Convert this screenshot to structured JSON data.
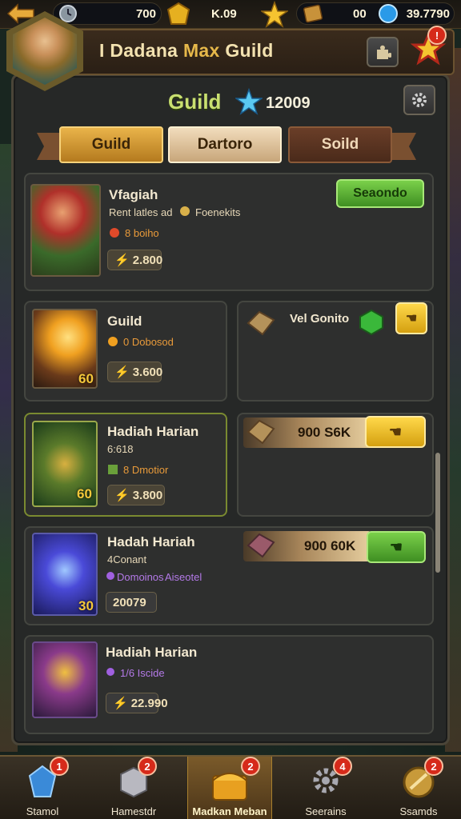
{
  "topbar": {
    "resources": [
      {
        "icon": "clock-coin-icon",
        "value": "700"
      },
      {
        "icon": "gold-coin-icon",
        "value": "K.09"
      },
      {
        "icon": "star-icon",
        "value": ""
      },
      {
        "icon": "scroll-icon",
        "value": "00"
      },
      {
        "icon": "blue-gem-icon",
        "value": "39.7790"
      }
    ]
  },
  "header": {
    "title_prefix": "I Dadana ",
    "title_highlight": "Max",
    "title_suffix": " Guild",
    "notification_count": "!"
  },
  "guild": {
    "name": "Guild",
    "score": "12009"
  },
  "tabs": [
    {
      "label": "Guild",
      "state": "selected-gold"
    },
    {
      "label": "Dartoro",
      "state": "active"
    },
    {
      "label": "Soild",
      "state": "inactive"
    }
  ],
  "cards": {
    "c1": {
      "name": "Vfagiah",
      "line1": "Rent latles ad",
      "line1b": "Foenekits",
      "line2": "8 boiho",
      "price": "2.800",
      "button": "Seaondo"
    },
    "c2": {
      "name": "Guild",
      "line1": "0 Dobosod",
      "price": "3.600",
      "badge": "60"
    },
    "c2b": {
      "label": "Vel Gonito"
    },
    "c3": {
      "name": "Hadiah Harian",
      "line1": "6:618",
      "line2": "8 Dmotior",
      "price": "3.800",
      "badge": "60"
    },
    "c3b": {
      "price": "900 S6K"
    },
    "c4": {
      "name": "Hadah Hariah",
      "line1": "4Conant",
      "line2": "Domoinos",
      "line2b": "Aiseotel",
      "price": "20079",
      "badge": "30"
    },
    "c4b": {
      "price": "900 60K"
    },
    "c5": {
      "name": "Hadiah Harian",
      "line1": "1/6 Iscide",
      "price": "22.990"
    }
  },
  "nav": [
    {
      "label": "Stamol",
      "badge": "1",
      "icon": "blue-crystal-icon"
    },
    {
      "label": "Hamestdr",
      "badge": "2",
      "icon": "silver-cube-icon"
    },
    {
      "label": "Madkan Meban",
      "badge": "2",
      "icon": "treasure-chest-icon",
      "active": true
    },
    {
      "label": "Seerains",
      "badge": "4",
      "icon": "gear-icon"
    },
    {
      "label": "Ssamds",
      "badge": "2",
      "icon": "shield-icon"
    }
  ],
  "colors": {
    "accent_gold": "#e9b34a",
    "accent_green": "#6bc43a",
    "badge_red": "#d62a1a"
  }
}
